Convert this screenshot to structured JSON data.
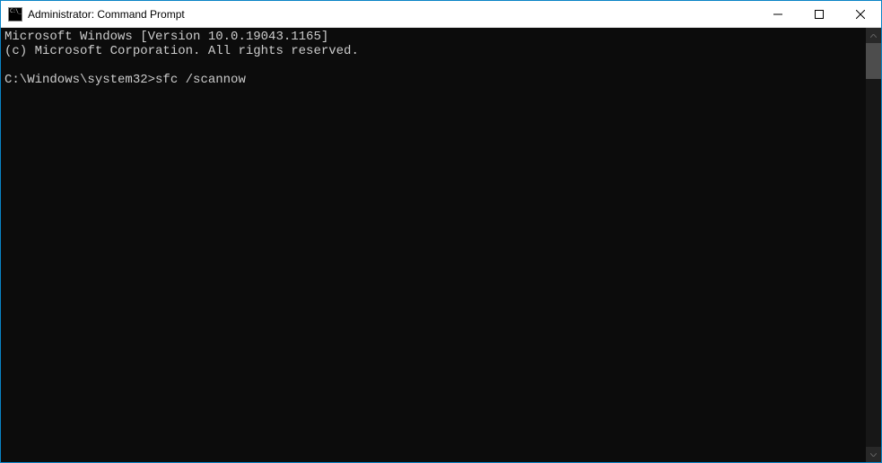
{
  "titlebar": {
    "title": "Administrator: Command Prompt"
  },
  "terminal": {
    "line1": "Microsoft Windows [Version 10.0.19043.1165]",
    "line2": "(c) Microsoft Corporation. All rights reserved.",
    "blank": "",
    "prompt": "C:\\Windows\\system32>",
    "command": "sfc /scannow"
  }
}
